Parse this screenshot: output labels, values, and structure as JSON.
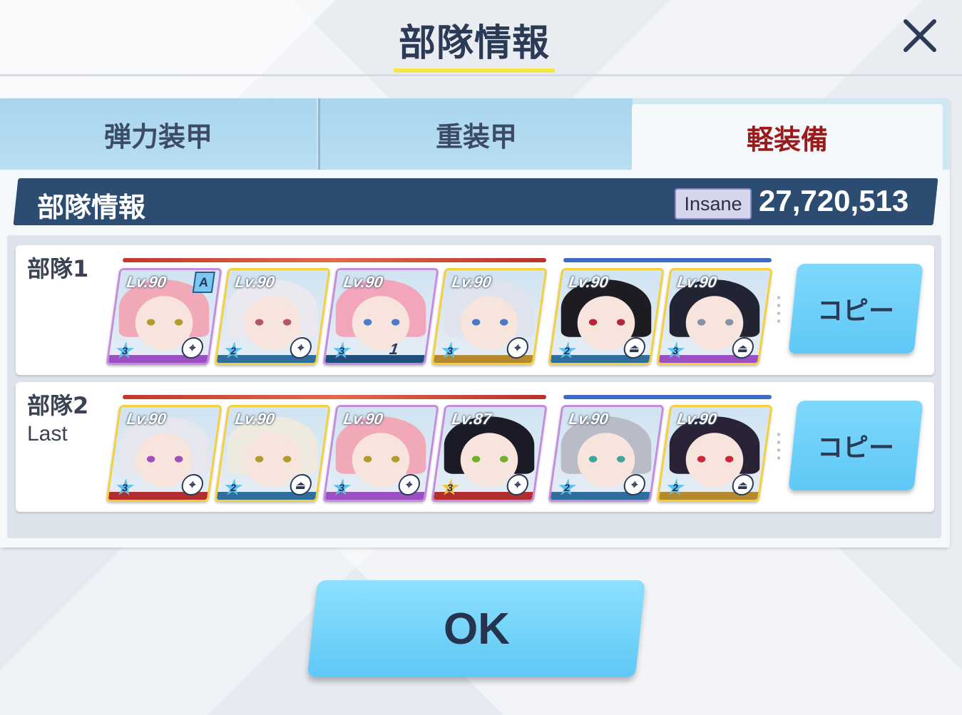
{
  "dialog": {
    "title": "部隊情報"
  },
  "tabs": [
    {
      "label": "弾力装甲"
    },
    {
      "label": "重装甲"
    },
    {
      "label": "軽装備",
      "selected": true
    }
  ],
  "header": {
    "title": "部隊情報",
    "difficulty": "Insane",
    "score": "27,720,513"
  },
  "squads": [
    {
      "label": "部隊1",
      "sub": "",
      "copy_label": "コピー",
      "cards": [
        {
          "lv": "Lv.90",
          "stars": "3",
          "assist": "A",
          "hair": "#f1a9b8",
          "eye": "#b59a2f",
          "bar": "#9b4fc0",
          "frame": "purple",
          "role": "target"
        },
        {
          "lv": "Lv.90",
          "stars": "2",
          "hair": "#e9e9ef",
          "eye": "#b2566e",
          "bar": "#2f6d9c",
          "frame": "gold",
          "role": "target"
        },
        {
          "lv": "Lv.90",
          "stars": "3",
          "hair": "#f3a6bb",
          "eye": "#4f79c9",
          "bar": "#1d4f7a",
          "frame": "purple",
          "role": "",
          "bond": "1"
        },
        {
          "lv": "Lv.90",
          "stars": "3",
          "hair": "#dfe3ee",
          "eye": "#4b78c2",
          "bar": "#b58a2f",
          "frame": "gold",
          "role": "target"
        },
        {
          "lv": "Lv.90",
          "stars": "2",
          "hair": "#1c1c22",
          "eye": "#b3253a",
          "bar": "#2f6d9c",
          "frame": "gold",
          "role": "support"
        },
        {
          "lv": "Lv.90",
          "stars": "3",
          "hair": "#222433",
          "eye": "#8792a8",
          "bar": "#9b4fc0",
          "frame": "gold",
          "role": "support"
        }
      ]
    },
    {
      "label": "部隊2",
      "sub": "Last",
      "copy_label": "コピー",
      "cards": [
        {
          "lv": "Lv.90",
          "stars": "3",
          "hair": "#e6e6ef",
          "eye": "#a04fb8",
          "bar": "#b22e2e",
          "frame": "gold",
          "role": "target"
        },
        {
          "lv": "Lv.90",
          "stars": "2",
          "hair": "#eeeadf",
          "eye": "#b59a2f",
          "bar": "#2f6d9c",
          "frame": "gold",
          "role": "support"
        },
        {
          "lv": "Lv.90",
          "stars": "3",
          "hair": "#f1a9b8",
          "eye": "#b59a2f",
          "bar": "#9b4fc0",
          "frame": "purple",
          "role": "target"
        },
        {
          "lv": "Lv.87",
          "stars": "3",
          "hair": "#1b1b28",
          "eye": "#6fb02a",
          "bar": "#b22e2e",
          "frame": "purple",
          "role": "target",
          "gold_star": true
        },
        {
          "lv": "Lv.90",
          "stars": "2",
          "hair": "#b9bcc6",
          "eye": "#3fa59a",
          "bar": "#2f6d9c",
          "frame": "purple",
          "role": "target"
        },
        {
          "lv": "Lv.90",
          "stars": "2",
          "hair": "#2a2338",
          "eye": "#c8283a",
          "bar": "#b58a2f",
          "frame": "gold",
          "role": "support"
        }
      ]
    }
  ],
  "ok_label": "OK"
}
